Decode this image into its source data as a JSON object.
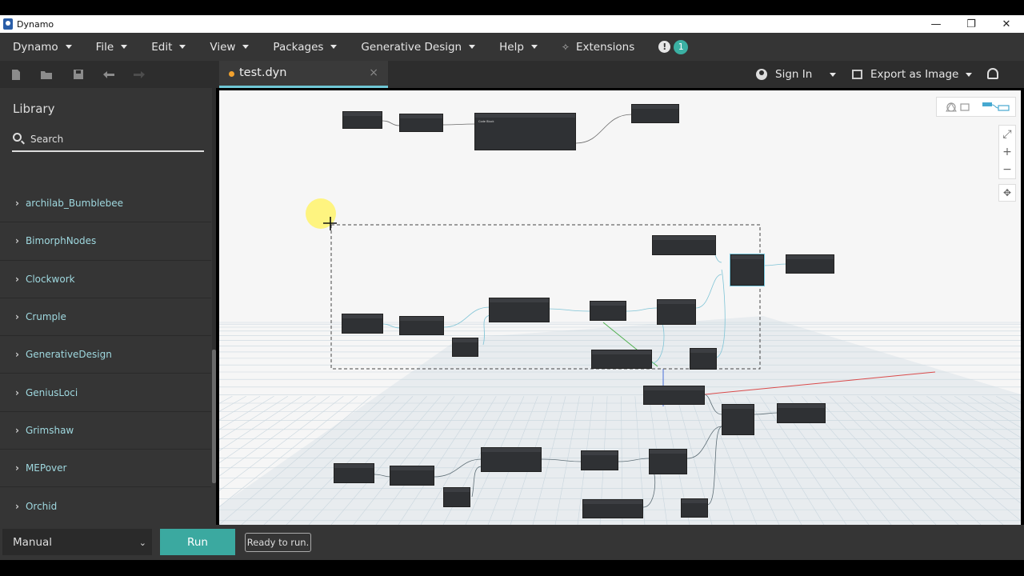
{
  "window": {
    "title": "Dynamo",
    "minimize": "—",
    "restore": "❐",
    "close": "✕"
  },
  "menu": {
    "items": [
      "Dynamo",
      "File",
      "Edit",
      "View",
      "Packages",
      "Generative Design",
      "Help"
    ],
    "extensions_label": "Extensions",
    "notification_count": "1",
    "alert_glyph": "!"
  },
  "toolbar": {
    "tab_label": "test.dyn",
    "tab_close": "×",
    "sign_in_label": "Sign In",
    "export_label": "Export as Image",
    "icons": {
      "new": "🗋",
      "open": "📂",
      "save": "💾",
      "undo": "↶",
      "redo": "↷"
    }
  },
  "library": {
    "title": "Library",
    "search_placeholder": "Search",
    "items": [
      "archilab_Bumblebee",
      "BimorphNodes",
      "Clockwork",
      "Crumple",
      "GenerativeDesign",
      "GeniusLoci",
      "Grimshaw",
      "MEPover",
      "Orchid"
    ]
  },
  "canvas": {
    "zoom_fit": "⤢",
    "zoom_in": "+",
    "zoom_out": "−",
    "pan": "✥",
    "code_block_title": "Code Block",
    "colors": {
      "accent": "#3ba9a0",
      "tab_dot": "#f2a12e",
      "link": "#9fd8df",
      "wire": "#7fc4d6",
      "axis_x": "#d94a4a",
      "axis_y": "#4fb04f",
      "axis_z": "#4a6fd9"
    }
  },
  "bottom": {
    "run_mode": "Manual",
    "run_label": "Run",
    "status": "Ready to run."
  }
}
